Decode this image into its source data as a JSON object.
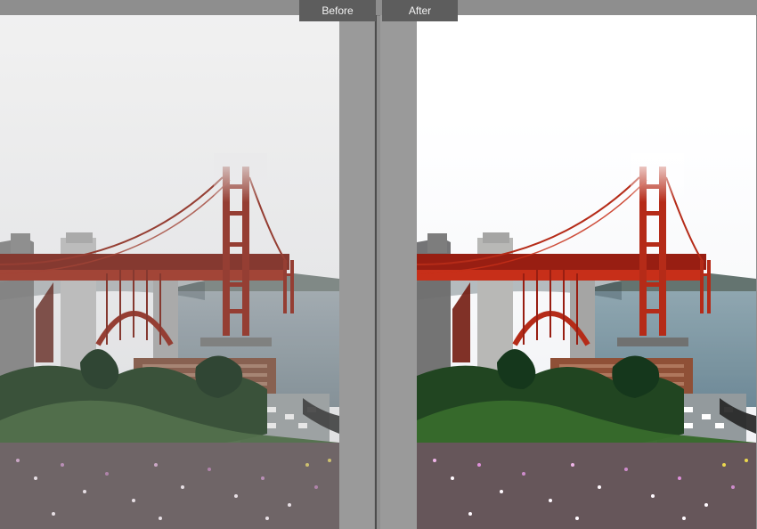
{
  "labels": {
    "before": "Before",
    "after": "After"
  },
  "colors": {
    "sky": "#e9eaeb",
    "bridge_red": "#a33324",
    "water": "#8e9ea7",
    "hills": "#6e7b77",
    "greenery": "#2f4d2f",
    "flowers": "#b97fb3"
  }
}
